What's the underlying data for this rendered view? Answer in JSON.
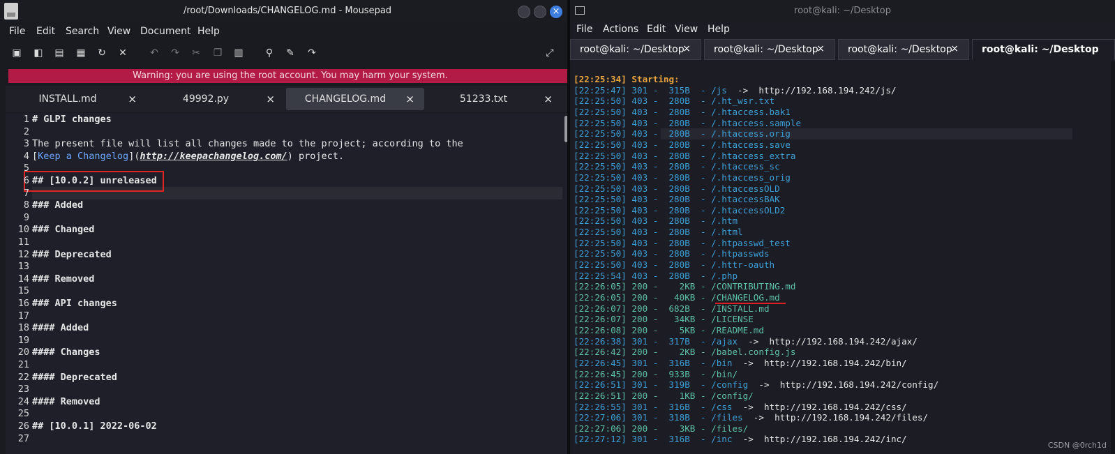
{
  "mousepad": {
    "title": "/root/Downloads/CHANGELOG.md - Mousepad",
    "menu": [
      "File",
      "Edit",
      "Search",
      "View",
      "Document",
      "Help"
    ],
    "warning": "Warning: you are using the root account. You may harm your system.",
    "tabs": [
      {
        "label": "INSTALL.md",
        "active": false
      },
      {
        "label": "49992.py",
        "active": false
      },
      {
        "label": "CHANGELOG.md",
        "active": true
      },
      {
        "label": "51233.txt",
        "active": false
      }
    ],
    "tab_close": "×",
    "lines": [
      {
        "n": "1",
        "text": "# GLPI changes",
        "style": "hd"
      },
      {
        "n": "2",
        "text": "",
        "style": ""
      },
      {
        "n": "3",
        "text": "The present file will list all changes made to the project; according to the",
        "style": ""
      },
      {
        "n": "4",
        "parts": {
          "open": "[",
          "link": "Keep a Changelog",
          "mid": "](",
          "url": "http://keepachangelog.com/",
          "close": ") project."
        }
      },
      {
        "n": "5",
        "text": "",
        "style": ""
      },
      {
        "n": "6",
        "text": "## [10.0.2] unreleased",
        "style": "hd"
      },
      {
        "n": "7",
        "text": "",
        "style": ""
      },
      {
        "n": "8",
        "text": "### Added",
        "style": "hd"
      },
      {
        "n": "9",
        "text": "",
        "style": ""
      },
      {
        "n": "10",
        "text": "### Changed",
        "style": "hd"
      },
      {
        "n": "11",
        "text": "",
        "style": ""
      },
      {
        "n": "12",
        "text": "### Deprecated",
        "style": "hd"
      },
      {
        "n": "13",
        "text": "",
        "style": ""
      },
      {
        "n": "14",
        "text": "### Removed",
        "style": "hd"
      },
      {
        "n": "15",
        "text": "",
        "style": ""
      },
      {
        "n": "16",
        "text": "### API changes",
        "style": "hd"
      },
      {
        "n": "17",
        "text": "",
        "style": ""
      },
      {
        "n": "18",
        "text": "#### Added",
        "style": "hd"
      },
      {
        "n": "19",
        "text": "",
        "style": ""
      },
      {
        "n": "20",
        "text": "#### Changes",
        "style": "hd"
      },
      {
        "n": "21",
        "text": "",
        "style": ""
      },
      {
        "n": "22",
        "text": "#### Deprecated",
        "style": "hd"
      },
      {
        "n": "23",
        "text": "",
        "style": ""
      },
      {
        "n": "24",
        "text": "#### Removed",
        "style": "hd"
      },
      {
        "n": "25",
        "text": "",
        "style": ""
      },
      {
        "n": "26",
        "text": "## [10.0.1] 2022-06-02",
        "style": "hd"
      },
      {
        "n": "27",
        "text": "",
        "style": ""
      }
    ]
  },
  "terminal": {
    "title": "root@kali: ~/Desktop",
    "menu": [
      "File",
      "Actions",
      "Edit",
      "View",
      "Help"
    ],
    "tabs": [
      {
        "label": "root@kali: ~/Desktop",
        "active": false
      },
      {
        "label": "root@kali: ~/Desktop",
        "active": false
      },
      {
        "label": "root@kali: ~/Desktop",
        "active": false
      },
      {
        "label": "root@kali: ~/Desktop",
        "active": true
      }
    ],
    "tab_close": "×",
    "lines": [
      {
        "text": "[22:25:34] Starting:",
        "kind": "start"
      },
      {
        "text": "[22:25:47] 301 -  315B  - /js  ",
        "arrow": "->",
        "dest": "  http://192.168.194.242/js/",
        "kind": "b"
      },
      {
        "text": "[22:25:50] 403 -  280B  - /.ht_wsr.txt",
        "kind": "b"
      },
      {
        "text": "[22:25:50] 403 -  280B  - /.htaccess.bak1",
        "kind": "b"
      },
      {
        "text": "[22:25:50] 403 -  280B  - /.htaccess.sample",
        "kind": "b"
      },
      {
        "text": "[22:25:50] 403 -  280B  - /.htaccess.orig",
        "kind": "b"
      },
      {
        "text": "[22:25:50] 403 -  280B  - /.htaccess.save",
        "kind": "b"
      },
      {
        "text": "[22:25:50] 403 -  280B  - /.htaccess_extra",
        "kind": "b"
      },
      {
        "text": "[22:25:50] 403 -  280B  - /.htaccess_sc",
        "kind": "b"
      },
      {
        "text": "[22:25:50] 403 -  280B  - /.htaccess_orig",
        "kind": "b"
      },
      {
        "text": "[22:25:50] 403 -  280B  - /.htaccessOLD",
        "kind": "b"
      },
      {
        "text": "[22:25:50] 403 -  280B  - /.htaccessBAK",
        "kind": "b"
      },
      {
        "text": "[22:25:50] 403 -  280B  - /.htaccessOLD2",
        "kind": "b"
      },
      {
        "text": "[22:25:50] 403 -  280B  - /.htm",
        "kind": "b"
      },
      {
        "text": "[22:25:50] 403 -  280B  - /.html",
        "kind": "b"
      },
      {
        "text": "[22:25:50] 403 -  280B  - /.htpasswd_test",
        "kind": "b"
      },
      {
        "text": "[22:25:50] 403 -  280B  - /.htpasswds",
        "kind": "b"
      },
      {
        "text": "[22:25:50] 403 -  280B  - /.httr-oauth",
        "kind": "b"
      },
      {
        "text": "[22:25:54] 403 -  280B  - /.php",
        "kind": "b"
      },
      {
        "text": "[22:26:05] 200 -    2KB - /CONTRIBUTING.md",
        "kind": "g"
      },
      {
        "text": "[22:26:05] 200 -   40KB - /CHANGELOG.md",
        "kind": "g"
      },
      {
        "text": "[22:26:07] 200 -  682B  - /INSTALL.md",
        "kind": "g"
      },
      {
        "text": "[22:26:07] 200 -   34KB - /LICENSE",
        "kind": "g"
      },
      {
        "text": "[22:26:08] 200 -    5KB - /README.md",
        "kind": "g"
      },
      {
        "text": "[22:26:38] 301 -  317B  - /ajax  ",
        "arrow": "->",
        "dest": "  http://192.168.194.242/ajax/",
        "kind": "b"
      },
      {
        "text": "[22:26:42] 200 -    2KB - /babel.config.js",
        "kind": "g"
      },
      {
        "text": "[22:26:45] 301 -  316B  - /bin  ",
        "arrow": "->",
        "dest": "  http://192.168.194.242/bin/",
        "kind": "b"
      },
      {
        "text": "[22:26:45] 200 -  933B  - /bin/",
        "kind": "g"
      },
      {
        "text": "[22:26:51] 301 -  319B  - /config  ",
        "arrow": "->",
        "dest": "  http://192.168.194.242/config/",
        "kind": "b"
      },
      {
        "text": "[22:26:51] 200 -    1KB - /config/",
        "kind": "g"
      },
      {
        "text": "[22:26:55] 301 -  316B  - /css  ",
        "arrow": "->",
        "dest": "  http://192.168.194.242/css/",
        "kind": "b"
      },
      {
        "text": "[22:27:06] 301 -  318B  - /files  ",
        "arrow": "->",
        "dest": "  http://192.168.194.242/files/",
        "kind": "b"
      },
      {
        "text": "[22:27:06] 200 -    3KB - /files/",
        "kind": "g"
      },
      {
        "text": "[22:27:12] 301 -  316B  - /inc  ",
        "arrow": "->",
        "dest": "  http://192.168.194.242/inc/",
        "kind": "b"
      }
    ],
    "watermark": "CSDN @0rch1d"
  }
}
